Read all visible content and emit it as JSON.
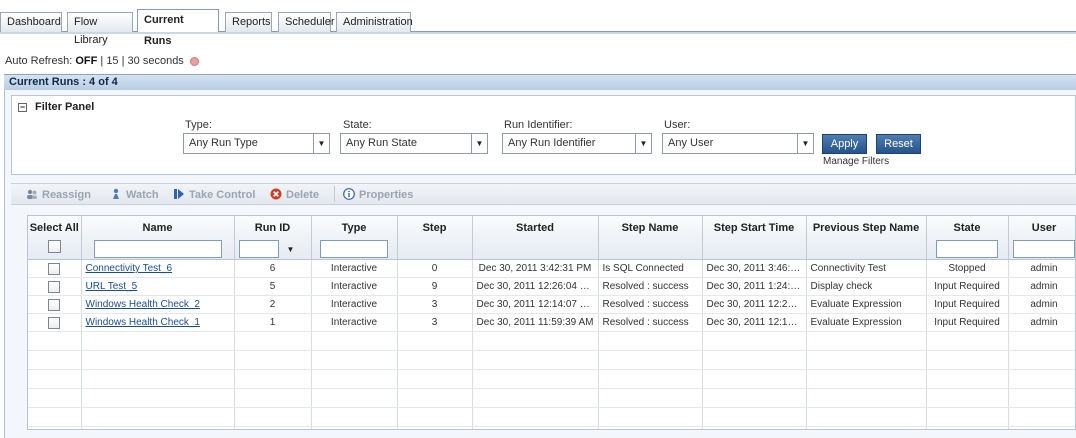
{
  "tabs": [
    {
      "label": "Dashboard"
    },
    {
      "label": "Flow Library"
    },
    {
      "label": "Current Runs"
    },
    {
      "label": "Reports"
    },
    {
      "label": "Scheduler"
    },
    {
      "label": "Administration"
    }
  ],
  "auto_refresh": {
    "prefix": "Auto Refresh: ",
    "state": "OFF",
    "separator1": " | ",
    "option1": "15",
    "separator2": " | ",
    "option2": "30 seconds"
  },
  "runs_header": "Current Runs : 4 of 4",
  "filter": {
    "title": "Filter Panel",
    "type_label": "Type:",
    "type_value": "Any Run Type",
    "state_label": "State:",
    "state_value": "Any Run State",
    "runid_label": "Run Identifier:",
    "runid_value": "Any Run Identifier",
    "user_label": "User:",
    "user_value": "Any User",
    "apply": "Apply",
    "reset": "Reset",
    "manage": "Manage Filters"
  },
  "toolbar": {
    "reassign": "Reassign",
    "watch": "Watch",
    "take_control": "Take Control",
    "delete": "Delete",
    "properties": "Properties"
  },
  "table": {
    "headers": [
      "Select All",
      "Name",
      "Run ID",
      "Type",
      "Step",
      "Started",
      "Step Name",
      "Step Start Time",
      "Previous Step Name",
      "State",
      "User"
    ],
    "rows": [
      {
        "name": "Connectivity Test_6",
        "run_id": "6",
        "type": "Interactive",
        "step": "0",
        "started": "Dec 30, 2011 3:42:31 PM",
        "step_name": "Is SQL Connected",
        "step_start": "Dec 30, 2011 3:46:1...",
        "prev_step": "Connectivity Test",
        "state": "Stopped",
        "user": "admin"
      },
      {
        "name": "URL Test_5",
        "run_id": "5",
        "type": "Interactive",
        "step": "9",
        "started": "Dec 30, 2011 12:26:04 PM",
        "step_name": "Resolved : success",
        "step_start": "Dec 30, 2011 1:24:3...",
        "prev_step": "Display check",
        "state": "Input Required",
        "user": "admin"
      },
      {
        "name": "Windows Health Check_2",
        "run_id": "2",
        "type": "Interactive",
        "step": "3",
        "started": "Dec 30, 2011 12:14:07 PM",
        "step_name": "Resolved : success",
        "step_start": "Dec 30, 2011 12:22:...",
        "prev_step": "Evaluate Expression",
        "state": "Input Required",
        "user": "admin"
      },
      {
        "name": "Windows Health Check_1",
        "run_id": "1",
        "type": "Interactive",
        "step": "3",
        "started": "Dec 30, 2011 11:59:39 AM",
        "step_name": "Resolved : success",
        "step_start": "Dec 30, 2011 12:14:...",
        "prev_step": "Evaluate Expression",
        "state": "Input Required",
        "user": "admin"
      }
    ]
  },
  "colors": {
    "accent": "#24548c",
    "header_band": "#b8cde4",
    "link": "#1a4d93"
  }
}
